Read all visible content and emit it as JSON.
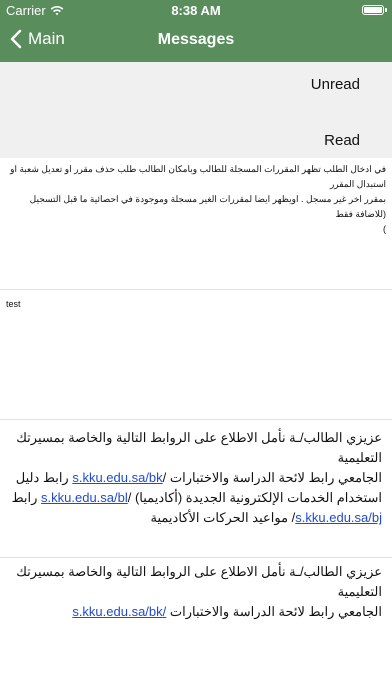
{
  "status_bar": {
    "carrier": "Carrier",
    "time": "8:38 AM",
    "battery_level": 1.0
  },
  "nav": {
    "back_label": "Main",
    "title": "Messages"
  },
  "filters": {
    "unread": "Unread",
    "read": "Read"
  },
  "messages": [
    {
      "lines": [
        "في ادخال الطلب تظهر المقررات المسجلة للطالب وبامكان الطالب طلب حذف مقرر او تعديل شعبة او استبدال المقرر",
        "بمقرر اخر غير مسجل . اويظهر ايضا لمقررات الغير مسجلة وموجودة في احصائية ما قبل التسجيل (للاضافة فقط",
        ")"
      ]
    },
    {
      "text": "test"
    },
    {
      "line1": "عزيزي الطالب/ـة نأمل الاطلاع على الروابط التالية والخاصة بمسيرتك التعليمية",
      "line2_text": "الجامعي رابط لائحة الدراسة والاختبارات /",
      "line2_link": "s.kku.edu.sa/bk",
      "line2_end": " رابط دليل",
      "line3_text": "استخدام الخدمات الإلكترونية الجديدة (أكاديميا) /",
      "line3_link": "s.kku.edu.sa/bl",
      "line3_end": " رابط",
      "line4_link": "s.kku.edu.sa/bj",
      "line4_text": "/ مواعيد الحركات الأكاديمية"
    },
    {
      "line1": "عزيزي الطالب/ـة نأمل الاطلاع على الروابط التالية والخاصة بمسيرتك التعليمية",
      "line2_text": "الجامعي رابط لائحة الدراسة والاختبارات",
      "line2_link": "/s.kku.edu.sa/bk"
    }
  ],
  "colors": {
    "nav_background": "#5a8d5c",
    "filter_background": "#f0f0f0",
    "link": "#1f4bd0"
  },
  "icons": {
    "back": "chevron-left-icon",
    "wifi": "wifi-icon",
    "battery": "battery-icon"
  }
}
